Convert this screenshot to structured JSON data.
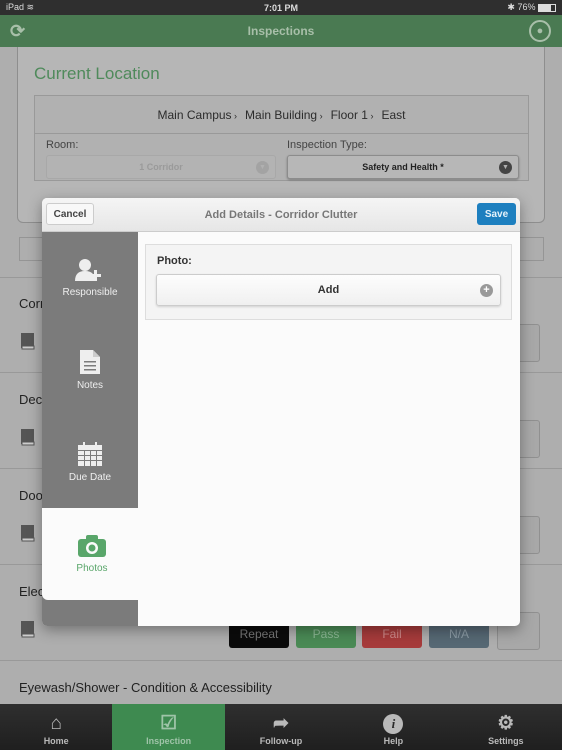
{
  "status_bar": {
    "device": "iPad",
    "time": "7:01 PM",
    "battery": "76%"
  },
  "nav": {
    "title": "Inspections",
    "refresh_icon": "refresh-icon",
    "user_icon": "user-icon"
  },
  "location": {
    "title": "Current Location",
    "breadcrumb": [
      "Main Campus",
      "Main Building",
      "Floor 1",
      "East"
    ],
    "room_label": "Room:",
    "room_value": "1 Corridor",
    "type_label": "Inspection Type:",
    "type_value": "Safety and Health *"
  },
  "list": {
    "items": [
      {
        "label": "Corr"
      },
      {
        "label": "Dec"
      },
      {
        "label": "Doo"
      },
      {
        "label": "Elec"
      },
      {
        "label": "Eyewash/Shower - Condition & Accessibility"
      }
    ],
    "row_buttons": {
      "repeat": "Repeat",
      "pass": "Pass",
      "fail": "Fail",
      "na": "N/A"
    },
    "colors": {
      "repeat": "#0b0b0b",
      "pass": "#4a8a55",
      "fail": "#a63b3b",
      "na": "#566874"
    }
  },
  "modal": {
    "title": "Add Details - Corridor Clutter",
    "cancel_label": "Cancel",
    "save_label": "Save",
    "sidebar": [
      {
        "label": "Responsible",
        "icon": "add-user-icon"
      },
      {
        "label": "Notes",
        "icon": "document-icon"
      },
      {
        "label": "Due Date",
        "icon": "calendar-icon"
      },
      {
        "label": "Photos",
        "icon": "camera-icon",
        "active": true
      }
    ],
    "photo_label": "Photo:",
    "add_label": "Add"
  },
  "tabbar": {
    "tabs": [
      {
        "label": "Home",
        "icon": "home-icon"
      },
      {
        "label": "Inspection",
        "icon": "clipboard-check-icon",
        "active": true
      },
      {
        "label": "Follow-up",
        "icon": "share-arrow-icon"
      },
      {
        "label": "Help",
        "icon": "info-icon"
      },
      {
        "label": "Settings",
        "icon": "gear-icon"
      }
    ]
  },
  "colors": {
    "brand_green": "#4a7a52",
    "save_blue": "#1d7fbf",
    "active_green": "#59a66a"
  }
}
